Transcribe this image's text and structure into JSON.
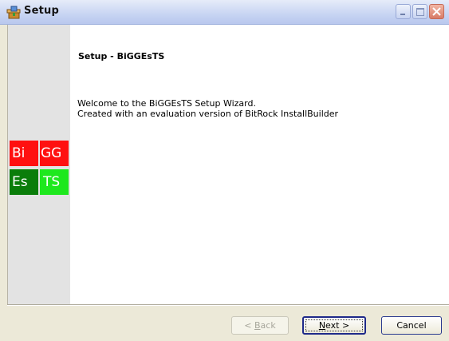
{
  "window": {
    "title": "Setup",
    "icon": "setup-installer-icon"
  },
  "titlebar_buttons": {
    "minimize_icon": "minimize-icon",
    "maximize_icon": "maximize-icon",
    "close_icon": "close-icon"
  },
  "sidebar": {
    "logo": {
      "cell_bi": "Bi",
      "cell_gg": "GG",
      "cell_es": "Es",
      "cell_ts": "TS",
      "colors": {
        "red": "#ff1010",
        "dark_green": "#0a7d0a",
        "bright_green": "#1ee81e"
      }
    }
  },
  "page": {
    "heading": "Setup - BiGGEsTS",
    "welcome_line_1": "Welcome to the BiGGEsTS Setup Wizard.",
    "welcome_line_2": "Created with an evaluation version of BitRock InstallBuilder"
  },
  "buttons": {
    "back_mnemonic": "B",
    "back_rest": "ack",
    "back_prefix": "< ",
    "next_mnemonic": "N",
    "next_rest": "ext >",
    "cancel_label": "Cancel"
  }
}
